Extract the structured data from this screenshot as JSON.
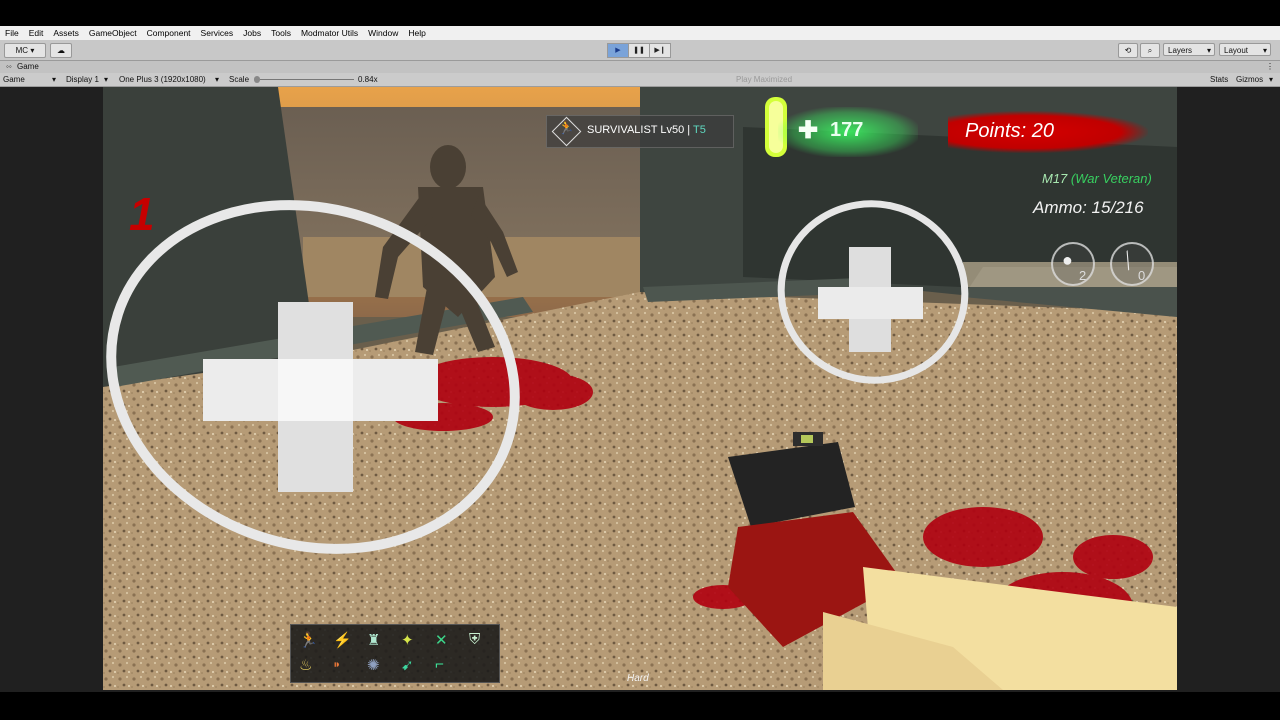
{
  "menu": [
    "File",
    "Edit",
    "Assets",
    "GameObject",
    "Component",
    "Services",
    "Jobs",
    "Tools",
    "Modmator Utils",
    "Window",
    "Help"
  ],
  "toolbar": {
    "account": "MC",
    "layers": "Layers",
    "layout": "Layout"
  },
  "game_tab": {
    "label": "Game"
  },
  "game_bar": {
    "view": "Game",
    "display": "Display 1",
    "resolution": "One Plus 3 (1920x1080)",
    "scale_label": "Scale",
    "scale_value": "0.84x",
    "maximize": "Play Maximized",
    "stats": "Stats",
    "gizmos": "Gizmos"
  },
  "hud": {
    "class_label": "SURVIVALIST Lv50 | ",
    "tier": "T5",
    "health": "177",
    "points": "Points: 20",
    "weapon_code": "M17",
    "weapon_desc": "(War Veteran)",
    "ammo": "Ammo: 15/216",
    "grenade_count": "2",
    "melee_count": "0",
    "round": "1",
    "difficulty": "Hard"
  },
  "colors": {
    "health": "#3de36a",
    "points_splat": "#d40000",
    "round": "#c60000",
    "weapon_code": "#a8e8b0",
    "weapon_desc": "#38d060"
  },
  "icons": [
    "sprint-perk-icon",
    "speed-perk-icon",
    "armor-perk-icon",
    "flash-perk-icon",
    "reload-perk-icon",
    "shield-perk-icon",
    "fire-perk-icon",
    "ammo-perk-icon",
    "explode-perk-icon",
    "boots-perk-icon",
    "gun-perk-icon"
  ]
}
